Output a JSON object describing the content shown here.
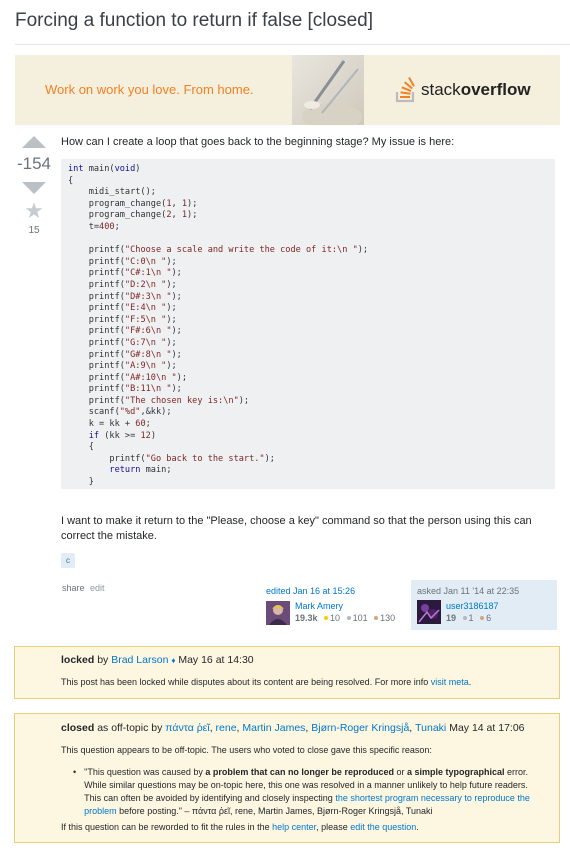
{
  "question": {
    "title": "Forcing a function to return if false [closed]",
    "vote_count": "-154",
    "favorite_count": "15",
    "body_intro": "How can I create a loop that goes back to the beginning stage? My issue is here:",
    "body_outro": "I want to make it return to the \"Please, choose a key\" command so that the person using this can correct the mistake.",
    "tag": "c"
  },
  "banner": {
    "text": "Work on work you love. From home.",
    "logo_word1": "stack",
    "logo_word2": "overflow"
  },
  "menu": {
    "share": "share",
    "edit": "edit"
  },
  "editor": {
    "time": "edited Jan 16 at 15:26",
    "name": "Mark Amery",
    "rep": "19.3k",
    "gold": "10",
    "silver": "101",
    "bronze": "130"
  },
  "asker": {
    "time": "asked Jan 11 '14 at 22:35",
    "name": "user3186187",
    "rep": "19",
    "silver": "1",
    "bronze": "6"
  },
  "lock_notice": {
    "word": "locked",
    "by": "by",
    "user": "Brad Larson",
    "diamond": "♦",
    "date": "May 16 at 14:30",
    "text": "This post has been locked while disputes about its content are being resolved. For more info",
    "link": "visit meta",
    "end": "."
  },
  "close_notice": {
    "word": "closed",
    "as": "as off-topic by",
    "users": [
      "πάντα ῥεῖ",
      "rene",
      "Martin James",
      "Bjørn-Roger Kringsjå",
      "Tunaki"
    ],
    "date": "May 14 at 17:06",
    "intro": "This question appears to be off-topic. The users who voted to close gave this specific reason:",
    "reason_a": "\"This question was caused by ",
    "reason_b": "a problem that can no longer be reproduced",
    "reason_c": " or ",
    "reason_d": "a simple typographical",
    "reason_e": " error. While similar questions may be on-topic here, this one was resolved in a manner unlikely to help future readers. This can often be avoided by identifying and closely inspecting ",
    "reason_link": "the shortest program necessary to reproduce the problem",
    "reason_f": " before posting.\" – πάντα ῥεῖ, rene, Martin James, Bjørn-Roger Kringsjå, Tunaki",
    "footer_a": "If this question can be reworded to fit the rules in the ",
    "footer_link1": "help center",
    "footer_b": ", please ",
    "footer_link2": "edit the question",
    "footer_c": "."
  }
}
